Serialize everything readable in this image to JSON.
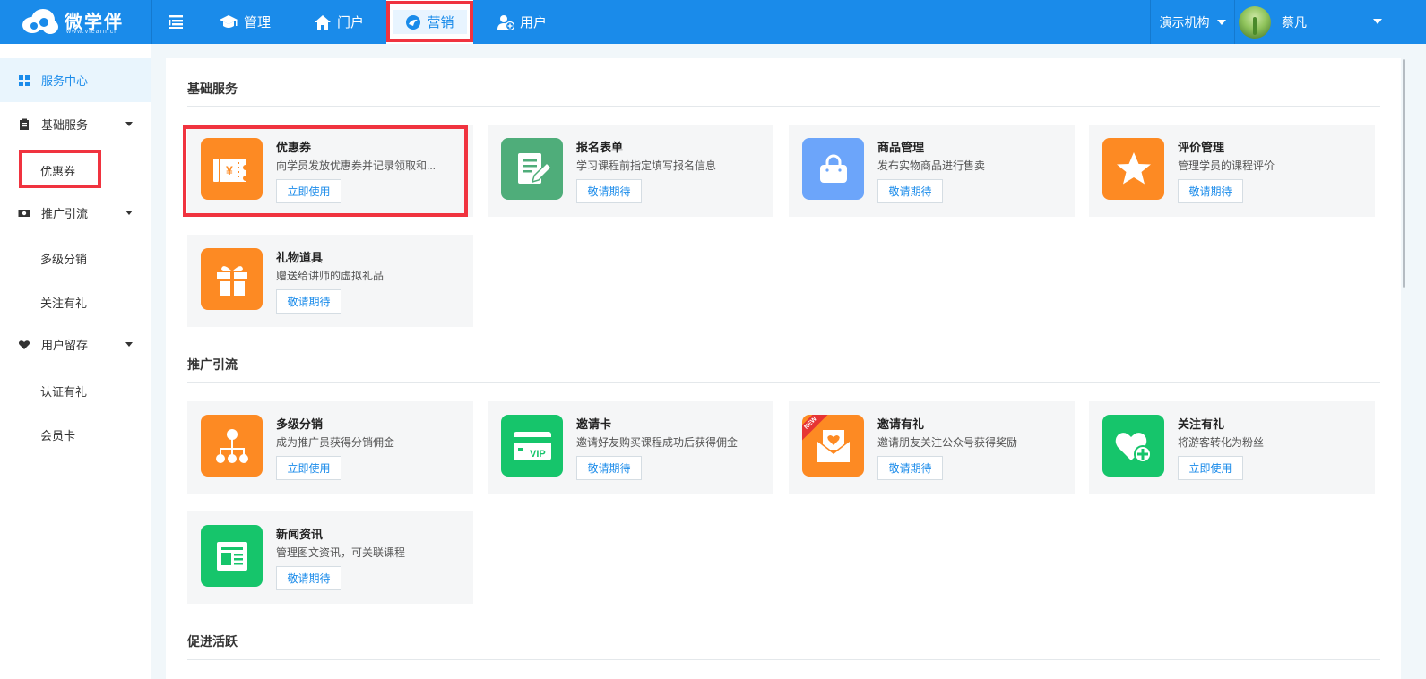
{
  "header": {
    "brand": "微学伴",
    "brand_sub": "www.vlearn.cn",
    "nav": [
      {
        "label": "管理",
        "icon": "graduation-cap-icon"
      },
      {
        "label": "门户",
        "icon": "home-icon"
      },
      {
        "label": "营销",
        "icon": "marketing-icon",
        "active": true
      },
      {
        "label": "用户",
        "icon": "user-add-icon"
      }
    ],
    "org_label": "演示机构",
    "user_name": "蔡凡"
  },
  "sidebar": {
    "items": [
      {
        "label": "服务中心",
        "icon": "grid-icon",
        "active": true
      },
      {
        "label": "基础服务",
        "icon": "clipboard-icon",
        "expandable": true
      },
      {
        "label": "推广引流",
        "icon": "money-icon",
        "expandable": true
      },
      {
        "label": "用户留存",
        "icon": "heart-icon",
        "expandable": true
      }
    ],
    "subitems": [
      "优惠券",
      "多级分销",
      "关注有礼",
      "认证有礼",
      "会员卡"
    ]
  },
  "sections": [
    {
      "title": "基础服务",
      "cards": [
        {
          "title": "优惠券",
          "desc": "向学员发放优惠券并记录领取和...",
          "button": "立即使用",
          "icon": "coupon-icon",
          "color": "#fd8a23"
        },
        {
          "title": "报名表单",
          "desc": "学习课程前指定填写报名信息",
          "button": "敬请期待",
          "icon": "form-edit-icon",
          "color": "#4fad7a"
        },
        {
          "title": "商品管理",
          "desc": "发布实物商品进行售卖",
          "button": "敬请期待",
          "icon": "shopping-bag-icon",
          "color": "#6ca5fa"
        },
        {
          "title": "评价管理",
          "desc": "管理学员的课程评价",
          "button": "敬请期待",
          "icon": "star-icon",
          "color": "#fd8a23"
        },
        {
          "title": "礼物道具",
          "desc": "赠送给讲师的虚拟礼品",
          "button": "敬请期待",
          "icon": "gift-icon",
          "color": "#fd8a23"
        }
      ]
    },
    {
      "title": "推广引流",
      "cards": [
        {
          "title": "多级分销",
          "desc": "成为推广员获得分销佣金",
          "button": "立即使用",
          "icon": "hierarchy-icon",
          "color": "#fd8a23"
        },
        {
          "title": "邀请卡",
          "desc": "邀请好友购买课程成功后获得佣金",
          "button": "敬请期待",
          "icon": "vip-card-icon",
          "color": "#16c56b",
          "icon_text": "VIP"
        },
        {
          "title": "邀请有礼",
          "desc": "邀请朋友关注公众号获得奖励",
          "button": "敬请期待",
          "icon": "heart-envelope-icon",
          "color": "#fd8a23",
          "badge": "NEW"
        },
        {
          "title": "关注有礼",
          "desc": "将游客转化为粉丝",
          "button": "立即使用",
          "icon": "heart-plus-icon",
          "color": "#16c56b"
        },
        {
          "title": "新闻资讯",
          "desc": "管理图文资讯，可关联课程",
          "button": "敬请期待",
          "icon": "news-icon",
          "color": "#16c56b"
        }
      ]
    },
    {
      "title": "促进活跃",
      "cards": []
    }
  ],
  "colors": {
    "primary": "#1a8bea",
    "highlight": "#f0333f",
    "orange": "#fd8a23",
    "green": "#16c56b"
  }
}
